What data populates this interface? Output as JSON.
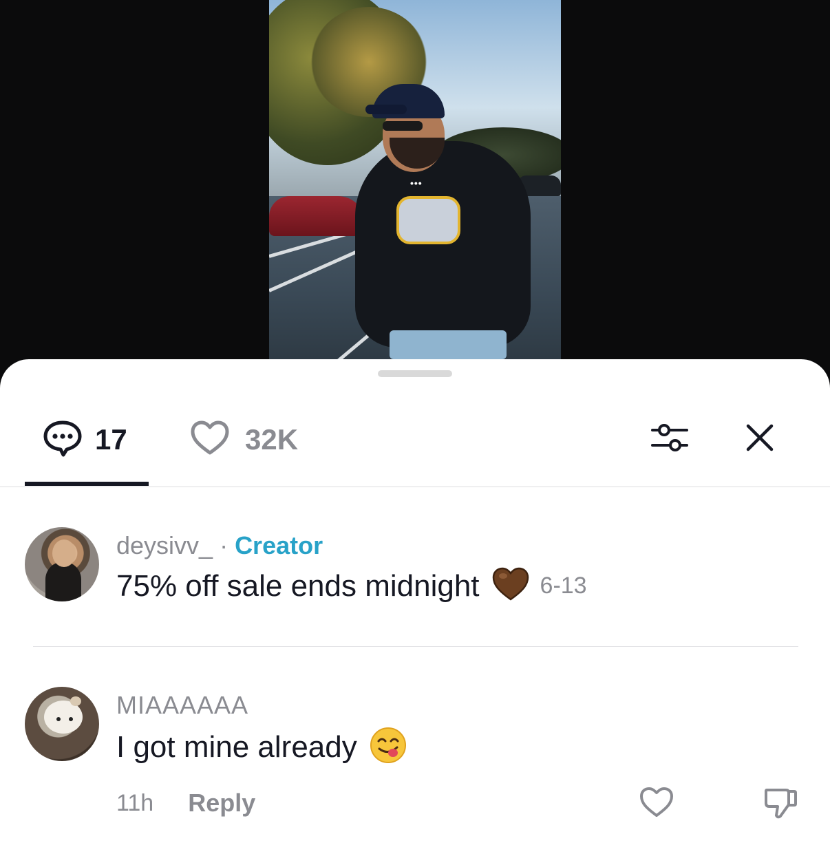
{
  "tabs": {
    "comments_count": "17",
    "likes_count": "32K"
  },
  "comments": [
    {
      "username": "deysivv_",
      "separator": "·",
      "badge": "Creator",
      "text": "75% off sale ends midnight",
      "emoji": "brown-heart",
      "date": "6-13"
    },
    {
      "username": "MIAAAAAA",
      "text": "I got mine already",
      "emoji": "face-savoring-food",
      "time": "11h",
      "reply_label": "Reply"
    }
  ],
  "colors": {
    "accent_creator": "#28a2c8",
    "text_primary": "#161823",
    "text_secondary": "#8a8b91",
    "sheet_bg": "#ffffff",
    "video_bg": "#0b0b0c"
  },
  "icons": [
    "comment-bubble-icon",
    "heart-outline-icon",
    "filter-sliders-icon",
    "close-icon",
    "brown-heart-emoji",
    "yum-face-emoji",
    "thumbs-down-icon"
  ]
}
